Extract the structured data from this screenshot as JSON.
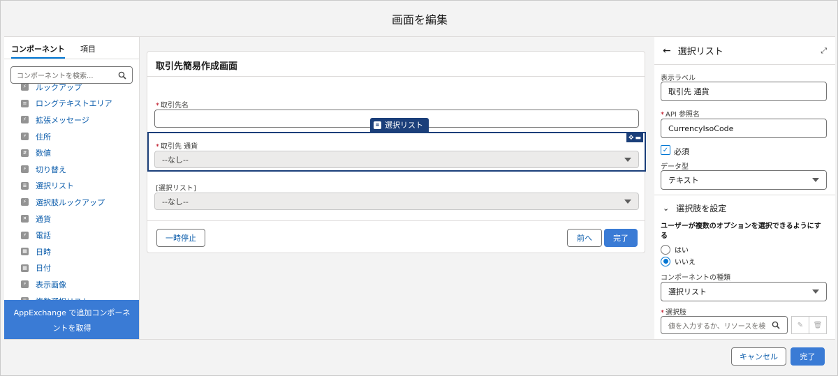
{
  "header": {
    "title": "画面を編集"
  },
  "left_panel": {
    "tabs": [
      {
        "label": "コンポーネント"
      },
      {
        "label": "項目"
      }
    ],
    "search": {
      "placeholder": "コンポーネントを検索..."
    },
    "components": [
      {
        "label": "ルックアップ",
        "icon": "component-icon"
      },
      {
        "label": "ロングテキストエリア",
        "icon": "text-area-icon"
      },
      {
        "label": "拡張メッセージ",
        "icon": "bolt-icon"
      },
      {
        "label": "住所",
        "icon": "bolt-icon"
      },
      {
        "label": "数値",
        "icon": "number-icon"
      },
      {
        "label": "切り替え",
        "icon": "bolt-icon"
      },
      {
        "label": "選択リスト",
        "icon": "list-icon"
      },
      {
        "label": "選択肢ルックアップ",
        "icon": "bolt-icon"
      },
      {
        "label": "通貨",
        "icon": "currency-icon"
      },
      {
        "label": "電話",
        "icon": "bolt-icon"
      },
      {
        "label": "日時",
        "icon": "calendar-icon"
      },
      {
        "label": "日付",
        "icon": "calendar-icon"
      },
      {
        "label": "表示画像",
        "icon": "bolt-icon"
      },
      {
        "label": "複数選択リスト",
        "icon": "list-icon"
      }
    ],
    "appexchange": {
      "label": "AppExchange で追加コンポーネントを取得"
    }
  },
  "canvas": {
    "screen_title": "取引先簡易作成画面",
    "fields": {
      "account_name": {
        "label": "取引先名",
        "required": "*"
      },
      "currency": {
        "label": "取引先 通貨",
        "required": "*",
        "value": "--なし--"
      },
      "picklist": {
        "label": "[選択リスト]",
        "value": "--なし--"
      }
    },
    "selected_pill": {
      "label": "選択リスト"
    },
    "buttons": {
      "pause": "一時停止",
      "previous": "前へ",
      "finish": "完了"
    }
  },
  "right_panel": {
    "title": "選択リスト",
    "display_label": {
      "label": "表示ラベル",
      "value": "取引先 通貨"
    },
    "api_name": {
      "label": "API 参照名",
      "required": "*",
      "value": "CurrencyIsoCode"
    },
    "required_checkbox": {
      "label": "必須",
      "checked": true
    },
    "data_type": {
      "label": "データ型",
      "value": "テキスト"
    },
    "choices_section": {
      "title": "選択肢を設定"
    },
    "multi_question": "ユーザーが複数のオプションを選択できるようにする",
    "radios": [
      {
        "label": "はい",
        "selected": false
      },
      {
        "label": "いいえ",
        "selected": true
      }
    ],
    "component_type": {
      "label": "コンポーネントの種類",
      "value": "選択リスト"
    },
    "choices": {
      "label": "選択肢",
      "required": "*",
      "placeholder": "値を入力するか、リソースを検"
    }
  },
  "footer": {
    "cancel": "キャンセル",
    "done": "完了"
  },
  "colors": {
    "brand": "#3a7bd5",
    "selected_border": "#1b3f7a",
    "link": "#0b5cab"
  }
}
